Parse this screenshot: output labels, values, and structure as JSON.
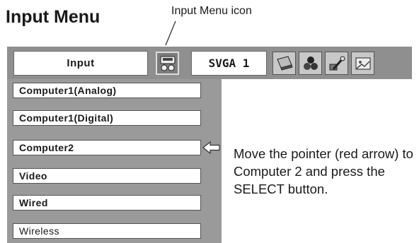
{
  "title": "Input Menu",
  "callout": "Input Menu icon",
  "toolbar": {
    "input_label": "Input",
    "signal_label": "SVGA 1",
    "icons": [
      "input-menu-icon",
      "screen-icon",
      "color-icon",
      "setting-icon",
      "image-icon"
    ]
  },
  "menu": {
    "items": [
      "Computer1(Analog)",
      "Computer1(Digital)",
      "Computer2",
      "Video",
      "Wired",
      "Wireless"
    ],
    "pointed_item": "Computer2"
  },
  "instruction": "Move the pointer (red arrow) to Computer 2 and press the SELECT button."
}
